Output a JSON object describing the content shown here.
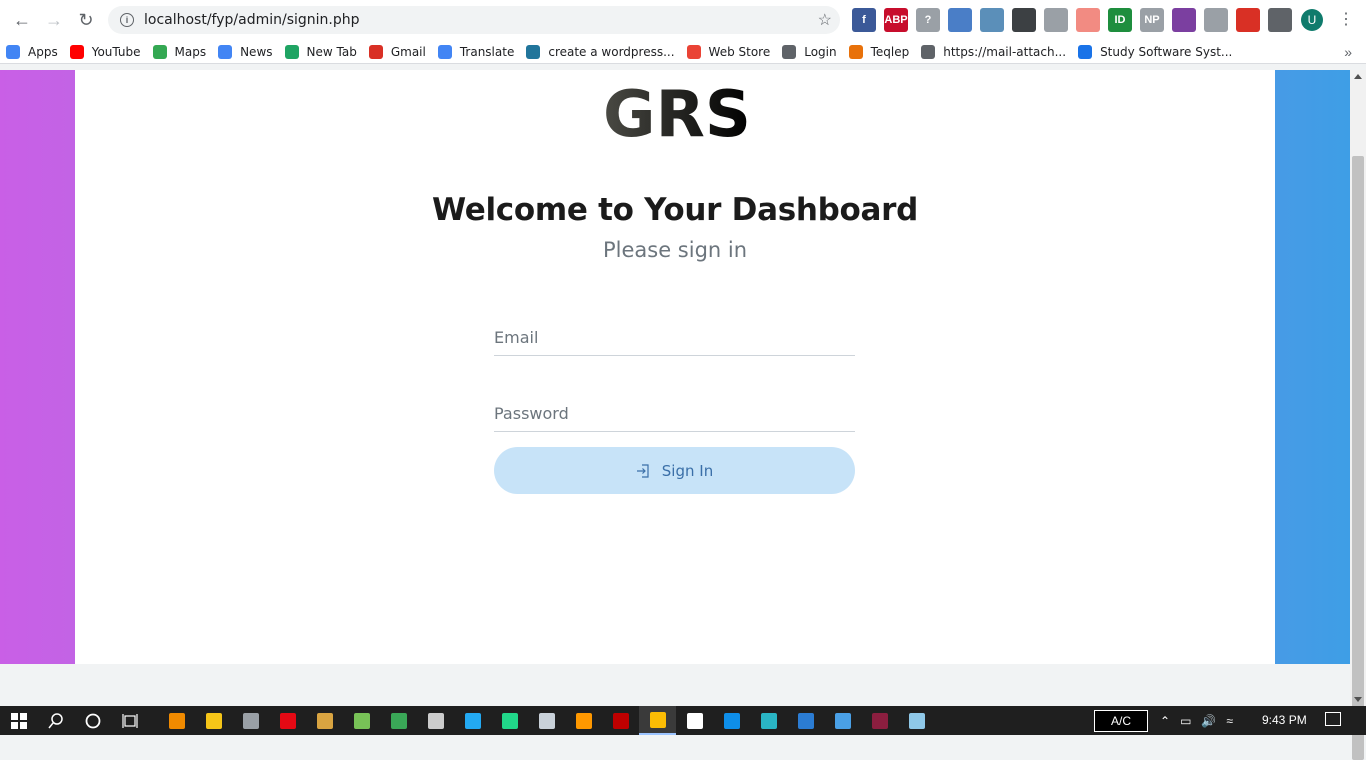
{
  "browser": {
    "url": "localhost/fyp/admin/signin.php",
    "profile_initial": "U",
    "extensions": [
      {
        "name": "facebook-icon",
        "label": "f",
        "color": "#3b5998"
      },
      {
        "name": "adblock-plus-icon",
        "label": "ABP",
        "color": "#c70d2c"
      },
      {
        "name": "shield-question-icon",
        "label": "?",
        "color": "#9aa0a6"
      },
      {
        "name": "camera-icon",
        "label": "",
        "color": "#4a7ec7"
      },
      {
        "name": "cloud-icon",
        "label": "",
        "color": "#5b8fb9"
      },
      {
        "name": "eyedropper-icon",
        "label": "",
        "color": "#3c4043"
      },
      {
        "name": "shield-icon",
        "label": "",
        "color": "#9aa0a6"
      },
      {
        "name": "arrow-icon",
        "label": "",
        "color": "#f28b82"
      },
      {
        "name": "id-icon",
        "label": "ID",
        "color": "#1e8e3e"
      },
      {
        "name": "np-icon",
        "label": "NP",
        "color": "#9aa0a6"
      },
      {
        "name": "purple-extension-icon",
        "label": "",
        "color": "#7b3fa0"
      },
      {
        "name": "screenshot-icon",
        "label": "",
        "color": "#9aa0a6"
      },
      {
        "name": "google-translate-ext-icon",
        "label": "",
        "color": "#d93025"
      },
      {
        "name": "puzzle-icon",
        "label": "",
        "color": "#5f6368"
      }
    ]
  },
  "bookmarks": [
    {
      "label": "Apps",
      "icon": "apps-grid-icon",
      "color": "#4285f4"
    },
    {
      "label": "YouTube",
      "icon": "youtube-icon",
      "color": "#ff0000"
    },
    {
      "label": "Maps",
      "icon": "maps-icon",
      "color": "#34a853"
    },
    {
      "label": "News",
      "icon": "news-icon",
      "color": "#4285f4"
    },
    {
      "label": "New Tab",
      "icon": "new-tab-icon",
      "color": "#1fa463"
    },
    {
      "label": "Gmail",
      "icon": "gmail-icon",
      "color": "#d93025"
    },
    {
      "label": "Translate",
      "icon": "translate-icon",
      "color": "#4285f4"
    },
    {
      "label": "create a wordpress...",
      "icon": "wordpress-icon",
      "color": "#21759b"
    },
    {
      "label": "Web Store",
      "icon": "web-store-icon",
      "color": "#ea4335"
    },
    {
      "label": "Login",
      "icon": "globe-icon",
      "color": "#5f6368"
    },
    {
      "label": "Teqlep",
      "icon": "teqlep-icon",
      "color": "#e8710a"
    },
    {
      "label": "https://mail-attach...",
      "icon": "globe-icon",
      "color": "#5f6368"
    },
    {
      "label": "Study Software Syst...",
      "icon": "study-icon",
      "color": "#1a73e8"
    }
  ],
  "page": {
    "logo_text": "GRS",
    "title": "Welcome to Your Dashboard",
    "subtitle": "Please sign in",
    "email_placeholder": "Email",
    "password_placeholder": "Password",
    "signin_label": "Sign In"
  },
  "taskbar": {
    "apps": [
      {
        "name": "vlc-icon",
        "color": "#f08a00"
      },
      {
        "name": "file-explorer-icon",
        "color": "#f5c518"
      },
      {
        "name": "app-icon",
        "color": "#9aa0a6"
      },
      {
        "name": "netflix-icon",
        "color": "#e50914"
      },
      {
        "name": "paint-icon",
        "color": "#d9a441"
      },
      {
        "name": "android-icon",
        "color": "#78c257"
      },
      {
        "name": "edge-legacy-icon",
        "color": "#3aa757"
      },
      {
        "name": "cmd-icon",
        "color": "#cccccc"
      },
      {
        "name": "vscode-icon",
        "color": "#23a9f2"
      },
      {
        "name": "pycharm-icon",
        "color": "#21d789"
      },
      {
        "name": "app2-icon",
        "color": "#c9d1d9"
      },
      {
        "name": "sublime-icon",
        "color": "#ff9800"
      },
      {
        "name": "filezilla-icon",
        "color": "#bf0000"
      },
      {
        "name": "chrome-icon",
        "color": "#fbbc04"
      },
      {
        "name": "document-icon",
        "color": "#ffffff"
      },
      {
        "name": "teamviewer-icon",
        "color": "#0e8ee9"
      },
      {
        "name": "edge-icon",
        "color": "#2ab5c4"
      },
      {
        "name": "word-icon",
        "color": "#2b7cd3"
      },
      {
        "name": "photos-icon",
        "color": "#4aa0e6"
      },
      {
        "name": "winrar-icon",
        "color": "#8b1e3f"
      },
      {
        "name": "notepad-icon",
        "color": "#8fc8e8"
      }
    ],
    "ac_label": "A/C",
    "time": "9:43 PM"
  }
}
